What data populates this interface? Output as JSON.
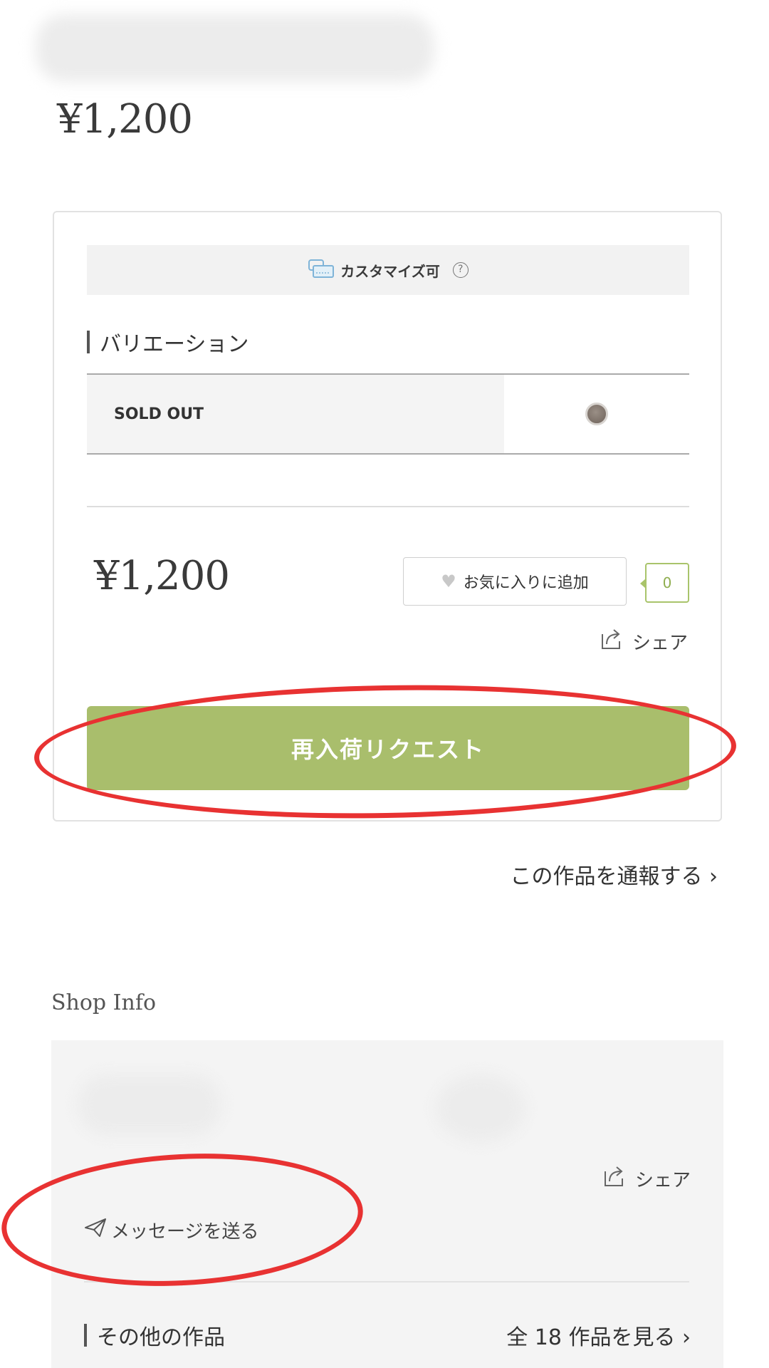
{
  "product": {
    "price": "¥1,200"
  },
  "card": {
    "customizable_label": "カスタマイズ可",
    "help_mark": "?",
    "variation_heading": "バリエーション",
    "variation": {
      "name": "SOLD OUT",
      "swatch_color": "#7d7068"
    },
    "price": "¥1,200",
    "favorite_label": "お気に入りに追加",
    "favorite_count": "0",
    "share_label": "シェア",
    "restock_button": "再入荷リクエスト"
  },
  "report_link": "この作品を通報する ›",
  "shop_info": {
    "title": "Shop Info",
    "share_label": "シェア",
    "message_label": "メッセージを送る",
    "other_works_heading": "その他の作品",
    "see_all_label": "全 18 作品を見る ›"
  },
  "colors": {
    "accent_green": "#a9be6c",
    "annotation_red": "#e83232"
  }
}
